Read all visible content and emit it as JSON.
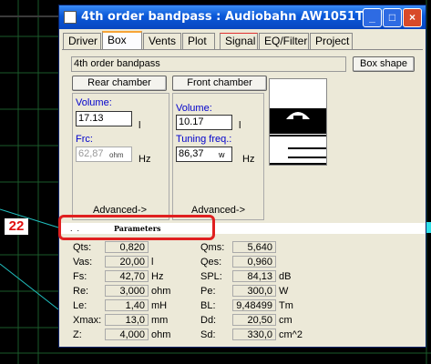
{
  "badge": "22",
  "window": {
    "title": "4th order bandpass : Audiobahn AW1051T",
    "buttons": {
      "minimize": "_",
      "maximize": "□",
      "close": "×"
    }
  },
  "tabs": [
    "Driver",
    "Box",
    "Vents",
    "Plot",
    "Signal",
    "EQ/Filter",
    "Project"
  ],
  "box": {
    "name": "4th order bandpass",
    "box_shape_label": "Box shape",
    "rear_chamber_label": "Rear chamber",
    "front_chamber_label": "Front chamber",
    "rear": {
      "volume_label": "Volume:",
      "volume_value": "17.13",
      "volume_unit": "l",
      "fc_label": "Frc:",
      "fc_value": "62,87",
      "fc_unit_small": "ohm",
      "fc_unit": "Hz",
      "advanced": "Advanced->"
    },
    "front": {
      "volume_label": "Volume:",
      "volume_value": "10.17",
      "volume_unit": "l",
      "tuning_label": "Tuning freq.:",
      "tuning_value": "86,37",
      "tuning_unit_small": "w",
      "tuning_unit": "Hz",
      "advanced": "Advanced->"
    }
  },
  "parameters": {
    "title": "Parameters",
    "left": [
      {
        "label": "Qts:",
        "value": "0,820",
        "unit": ""
      },
      {
        "label": "Vas:",
        "value": "20,00",
        "unit": "l"
      },
      {
        "label": "Fs:",
        "value": "42,70",
        "unit": "Hz"
      },
      {
        "label": "Re:",
        "value": "3,000",
        "unit": "ohm"
      },
      {
        "label": "Le:",
        "value": "1,40",
        "unit": "mH"
      },
      {
        "label": "Xmax:",
        "value": "13,0",
        "unit": "mm"
      },
      {
        "label": "Z:",
        "value": "4,000",
        "unit": "ohm"
      }
    ],
    "right": [
      {
        "label": "Qms:",
        "value": "5,640",
        "unit": ""
      },
      {
        "label": "Qes:",
        "value": "0,960",
        "unit": ""
      },
      {
        "label": "SPL:",
        "value": "84,13",
        "unit": "dB"
      },
      {
        "label": "Pe:",
        "value": "300,0",
        "unit": "W"
      },
      {
        "label": "BL:",
        "value": "9,48499",
        "unit": "Tm"
      },
      {
        "label": "Dd:",
        "value": "20,50",
        "unit": "cm"
      },
      {
        "label": "Sd:",
        "value": "330,0",
        "unit": "cm^2"
      }
    ]
  }
}
